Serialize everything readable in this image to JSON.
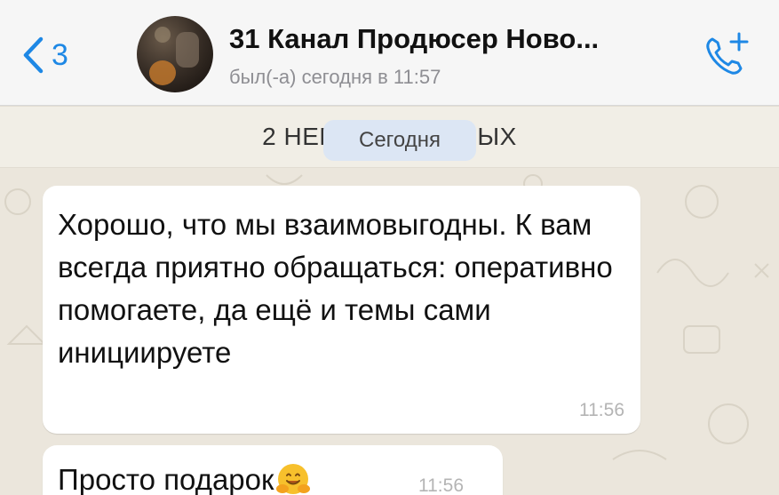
{
  "header": {
    "back_count": "3",
    "title": "31 Канал Продюсер Ново...",
    "status": "был(-а) сегодня в 11:57"
  },
  "chat": {
    "unread_banner": "2 НЕПРОЧИТАННЫХ",
    "date_pill": "Сегодня",
    "messages": [
      {
        "text": "Хорошо, что мы взаимовыгодны. К вам всегда приятно обращаться: оперативно помогаете, да ещё и темы сами инициируете",
        "time": "11:56"
      },
      {
        "text": "Просто подарок",
        "time": "11:56"
      }
    ]
  },
  "colors": {
    "accent": "#1e88e5",
    "bubble": "#ffffff",
    "background": "#ebe6dc",
    "date_pill": "#dce6f4"
  },
  "icons": {
    "back": "chevron-left-icon",
    "call": "phone-plus-icon",
    "emoji": "hugging-face-emoji"
  }
}
